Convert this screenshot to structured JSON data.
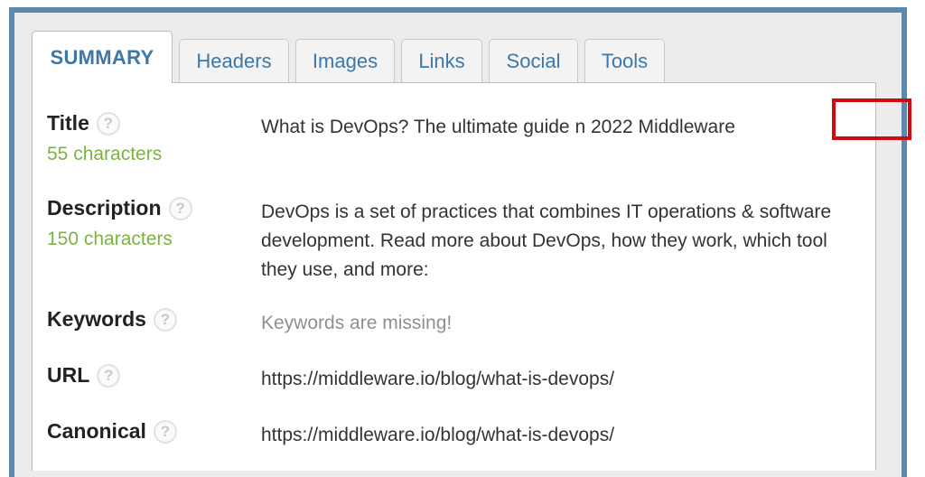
{
  "tabs": [
    {
      "label": "SUMMARY",
      "active": true
    },
    {
      "label": "Headers"
    },
    {
      "label": "Images"
    },
    {
      "label": "Links"
    },
    {
      "label": "Social"
    },
    {
      "label": "Tools"
    }
  ],
  "help_glyph": "?",
  "rows": {
    "title": {
      "label": "Title",
      "count": "55 characters",
      "value_pre": "What is DevOps? The ultimate guide",
      "value_highlight": "n 2022",
      "value_post": "Middleware"
    },
    "description": {
      "label": "Description",
      "count": "150 characters",
      "value": "DevOps is a set of practices that combines IT operations & software development. Read more about DevOps, how they work, which tool they use, and more:"
    },
    "keywords": {
      "label": "Keywords",
      "value": "Keywords are missing!"
    },
    "url": {
      "label": "URL",
      "value": "https://middleware.io/blog/what-is-devops/"
    },
    "canonical": {
      "label": "Canonical",
      "value": "https://middleware.io/blog/what-is-devops/"
    }
  },
  "colors": {
    "frame_border": "#5b88ad",
    "tab_text": "#3e77a6",
    "count_text": "#7cb342",
    "highlight_border": "#d10a10"
  }
}
